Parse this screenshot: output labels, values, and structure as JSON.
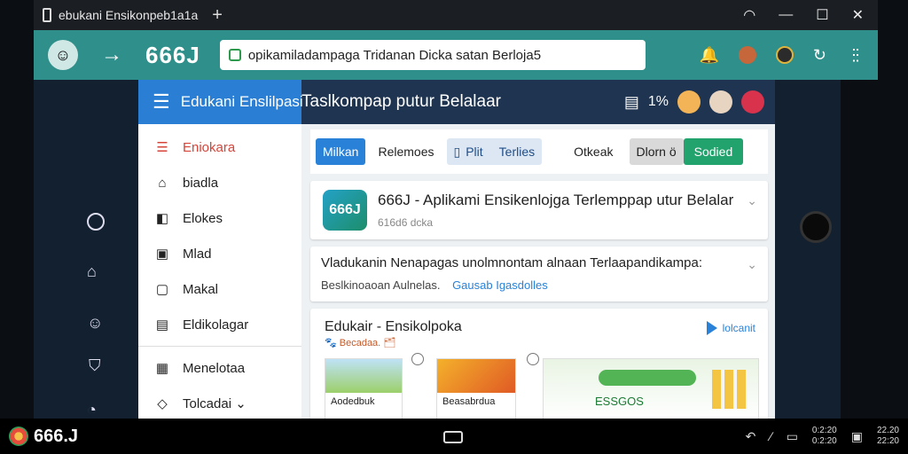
{
  "window": {
    "tab_title": "ebukani Ensikonpeb1a1a",
    "new_tab": "+",
    "controls": {
      "minimize": "—",
      "maximize": "☐",
      "close": "✕"
    }
  },
  "addressbar": {
    "back": "→",
    "brand": "666J",
    "url": "opikamiladampaga Tridanan Dicka satan Berloja5",
    "icons": [
      "bell-icon",
      "avatar-icon",
      "badge-icon",
      "refresh-icon",
      "more-icon"
    ]
  },
  "left_rail": {
    "icons": [
      "circle-icon",
      "folder-icon",
      "chat-icon",
      "shield-icon",
      "search-icon"
    ]
  },
  "app_header": {
    "menu": "☰",
    "title": "Edukani Enslilpasi",
    "subtitle": "Taslkompap putur Belalaar",
    "percent": "1%"
  },
  "sidebar": {
    "items": [
      {
        "icon": "☰",
        "label": "Eniokara",
        "active": true
      },
      {
        "icon": "⌂",
        "label": "biadla"
      },
      {
        "icon": "◧",
        "label": "Elokes"
      },
      {
        "icon": "▣",
        "label": "Mlad"
      },
      {
        "icon": "▢",
        "label": "Makal"
      },
      {
        "icon": "▤",
        "label": "Eldikolagar"
      },
      {
        "icon": "▦",
        "label": "Menelotaa"
      },
      {
        "icon": "◇",
        "label": "Tolcadai ⌄"
      }
    ]
  },
  "filters": {
    "primary": "Milkan",
    "relemoes": "Relemoes",
    "plit": "Plit",
    "terlies": "Terlies",
    "otkeak": "Otkeak",
    "dlorn": "Dlorn ö",
    "sodied": "Sodied"
  },
  "cards": {
    "app_title": "666J - Aplikami Ensikenlojga Terlemppap utur Belalar",
    "app_logo": "666J",
    "app_sub": "616d6 dcka",
    "desc": "Vladukanin Nenapagas unolmnontam alnaan Terlaapandikampa:",
    "desc_sub": "Beslkinoaoan Aulnelas.",
    "desc_link": "Gausab Igasdolles",
    "section_title": "Edukair - Ensikolpoka",
    "section_sub": "🐾 Becadaa. 🗂",
    "section_badge": "lolcanit",
    "thumb1": "Aodedbuk",
    "thumb2": "Beasabrdua",
    "thumb3": "ESSGOS"
  },
  "taskbar": {
    "brand": "666.J",
    "time_top": "0:2:20",
    "time_bot": "0:2:20",
    "clock_top": "22.20",
    "clock_bot": "22:20"
  }
}
